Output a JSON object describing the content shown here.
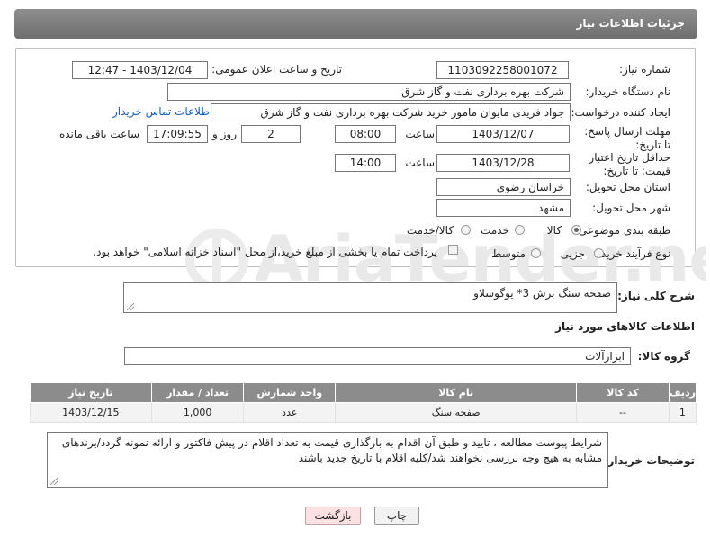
{
  "title": "جزئیات اطلاعات نیاز",
  "watermark": "AriaTender.neT",
  "need_number": {
    "label": "شماره نیاز:",
    "value": "1103092258001072"
  },
  "announce": {
    "label": "تاریخ و ساعت اعلان عمومی:",
    "value": "1403/12/04 - 12:47"
  },
  "buyer": {
    "label": "نام دستگاه خریدار:",
    "value": "شرکت بهره برداری نفت و گاز شرق"
  },
  "creator": {
    "label": "ایجاد کننده درخواست:",
    "value": "جواد فریدی مایوان مامور خرید شرکت بهره برداری نفت و گاز شرق",
    "contact_link": "اطلاعات تماس خریدار"
  },
  "deadline": {
    "label": "مهلت ارسال پاسخ: تا تاریخ:",
    "date": "1403/12/07",
    "time_label": "ساعت",
    "time": "08:00",
    "days": "2",
    "days_label": "روز و",
    "remaining": "17:09:55",
    "remaining_label": "ساعت باقی مانده"
  },
  "validity": {
    "label": "حداقل تاریخ اعتبار قیمت: تا تاریخ:",
    "date": "1403/12/28",
    "time_label": "ساعت",
    "time": "14:00"
  },
  "province": {
    "label": "استان محل تحویل:",
    "value": "خراسان رضوی"
  },
  "city": {
    "label": "شهر محل تحویل:",
    "value": "مشهد"
  },
  "category": {
    "label": "طبقه بندی موضوعی:",
    "options": [
      "کالا",
      "خدمت",
      "کالا/خدمت"
    ],
    "selected": "کالا"
  },
  "process": {
    "label": "نوع فرآیند خرید :",
    "options": [
      "جزیی",
      "متوسط"
    ],
    "payment_note": "پرداخت تمام یا بخشی از مبلغ خرید،از محل \"اسناد خزانه اسلامی\" خواهد بود."
  },
  "general_desc": {
    "label": "شرح کلی نیاز:",
    "value": "صفحه سنگ برش 3* یوگوسلاو"
  },
  "goods_info_heading": "اطلاعات کالاهای مورد نیاز",
  "goods_group": {
    "label": "گروه کالا:",
    "value": "ابزارآلات"
  },
  "table": {
    "headers": [
      "ردیف",
      "کد کالا",
      "نام کالا",
      "واحد شمارش",
      "تعداد / مقدار",
      "تاریخ نیاز"
    ],
    "rows": [
      [
        "1",
        "--",
        "صفحه سنگ",
        "عدد",
        "1,000",
        "1403/12/15"
      ]
    ]
  },
  "buyer_notes": {
    "label": "توضیحات خریدار:",
    "value": "شرایط پیوست مطالعه ، تایید و طبق آن اقدام به بارگذاری قیمت به تعداد اقلام در پیش فاکتور و ارائه نمونه گردد/برندهای مشابه به هیچ وجه بررسی نخواهند شد/کلیه اقلام با تاریخ جدید باشند"
  },
  "buttons": {
    "print": "چاپ",
    "back": "بازگشت"
  }
}
